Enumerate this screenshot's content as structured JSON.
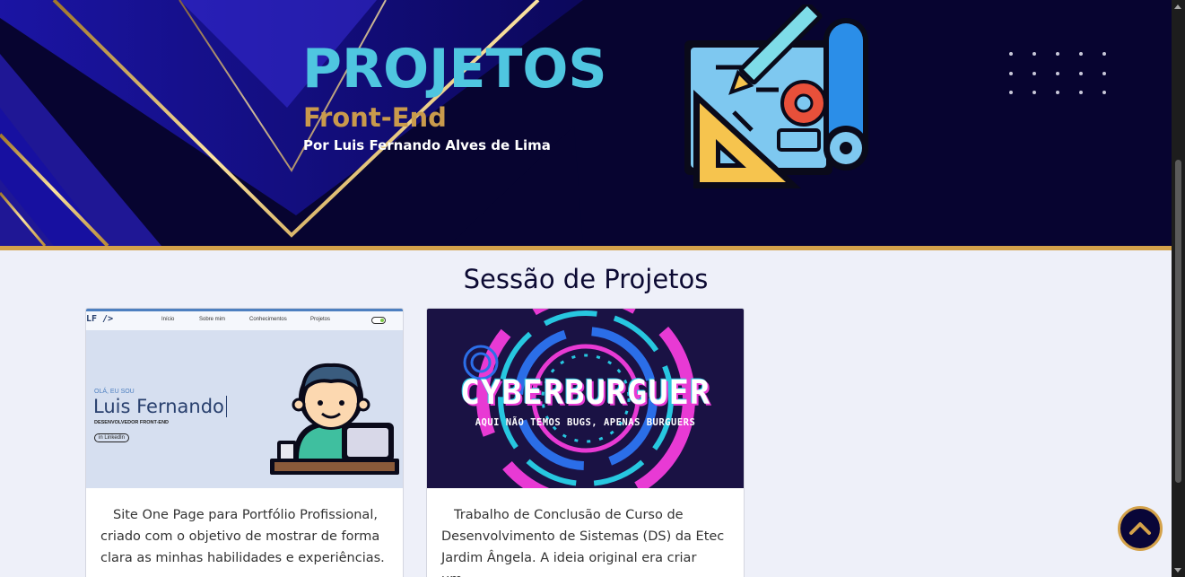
{
  "hero": {
    "title": "PROJETOS",
    "subtitle": "Front-End",
    "author": "Por Luis Fernando Alves de Lima",
    "illustration_icon": "blueprint-tools-icon",
    "colors": {
      "title": "#4fc6e0",
      "subtitle": "#c99a4c",
      "background": "#080534",
      "gold": "#d4a24a"
    }
  },
  "section": {
    "title": "Sessão de Projetos"
  },
  "projects": [
    {
      "thumb": {
        "logo": "LF />",
        "nav": [
          "Início",
          "Sobre mim",
          "Conhecimentos",
          "Projetos"
        ],
        "greeting": "OLÁ, EU SOU",
        "name": "Luis Fernando",
        "role": "DESENVOLVEDOR FRONT-END",
        "button": "in LinkedIn",
        "avatar_icon": "developer-at-desk-icon"
      },
      "description": "Site One Page para Portfólio Profissional, criado com o objetivo de mostrar de forma clara as minhas habilidades e experiências."
    },
    {
      "thumb": {
        "title": "CYBERBURGUER",
        "subtitle": "AQUI NÃO TEMOS BUGS, APENAS BURGUERS"
      },
      "description": "Trabalho de Conclusão de Curso de Desenvolvimento de Sistemas (DS) da Etec Jardim Ângela. A ideia original era criar um..."
    }
  ],
  "back_to_top": {
    "icon": "chevron-up-icon"
  }
}
